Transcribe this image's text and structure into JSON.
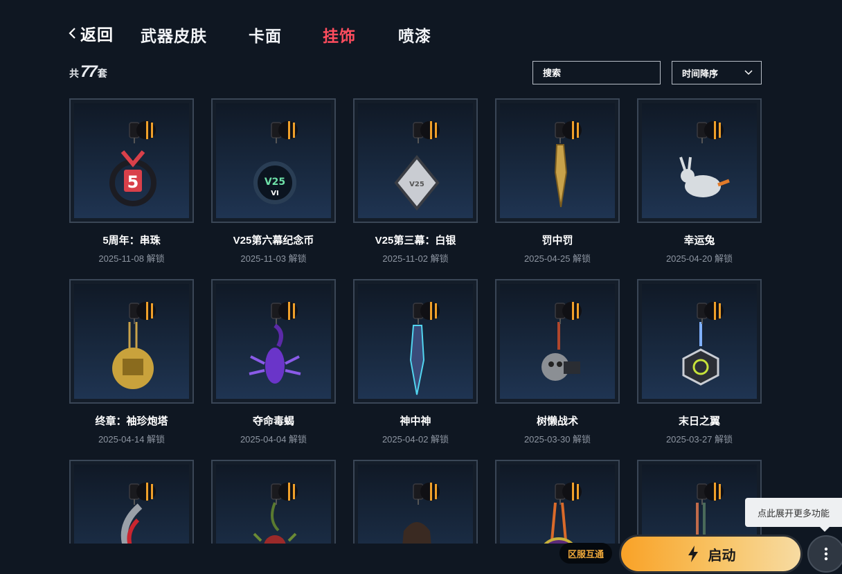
{
  "nav": {
    "back_label": "返回",
    "tabs": [
      {
        "label": "武器皮肤",
        "active": false
      },
      {
        "label": "卡面",
        "active": false
      },
      {
        "label": "挂饰",
        "active": true
      },
      {
        "label": "喷漆",
        "active": false
      }
    ]
  },
  "count": {
    "prefix": "共",
    "value": "77",
    "suffix": "套"
  },
  "search": {
    "placeholder": "搜索"
  },
  "sort": {
    "value": "时间降序"
  },
  "items": [
    {
      "name": "5周年：串珠",
      "date": "2025-11-08 解锁",
      "icon": "beads-charm-icon"
    },
    {
      "name": "V25第六幕纪念币",
      "date": "2025-11-03 解锁",
      "icon": "coin-charm-icon"
    },
    {
      "name": "V25第三幕：白银",
      "date": "2025-11-02 解锁",
      "icon": "silver-diamond-charm-icon"
    },
    {
      "name": "罚中罚",
      "date": "2025-04-25 解锁",
      "icon": "golden-blade-charm-icon"
    },
    {
      "name": "幸运兔",
      "date": "2025-04-20 解锁",
      "icon": "rabbit-charm-icon"
    },
    {
      "name": "终章：袖珍炮塔",
      "date": "2025-04-14 解锁",
      "icon": "turret-charm-icon"
    },
    {
      "name": "夺命毒蝎",
      "date": "2025-04-04 解锁",
      "icon": "scorpion-charm-icon"
    },
    {
      "name": "神中神",
      "date": "2025-04-02 解锁",
      "icon": "crystal-blade-charm-icon"
    },
    {
      "name": "树懒战术",
      "date": "2025-03-30 解锁",
      "icon": "sloth-charm-icon"
    },
    {
      "name": "末日之翼",
      "date": "2025-03-27 解锁",
      "icon": "wing-emblem-charm-icon"
    },
    {
      "name": "",
      "date": "",
      "icon": "red-hook-charm-icon"
    },
    {
      "name": "",
      "date": "",
      "icon": "plant-charm-icon"
    },
    {
      "name": "",
      "date": "",
      "icon": "agent-figure-charm-icon"
    },
    {
      "name": "",
      "date": "",
      "icon": "purple-ball-charm-icon"
    },
    {
      "name": "",
      "date": "",
      "icon": "strap-charm-icon"
    }
  ],
  "tooltip": {
    "text": "点此展开更多功能"
  },
  "region_badge": {
    "text": "区服互通"
  },
  "launch": {
    "label": "启动"
  },
  "colors": {
    "accent_tab": "#ff4d5e",
    "launch_gradient_start": "#f9a227",
    "background": "#0f1722"
  }
}
